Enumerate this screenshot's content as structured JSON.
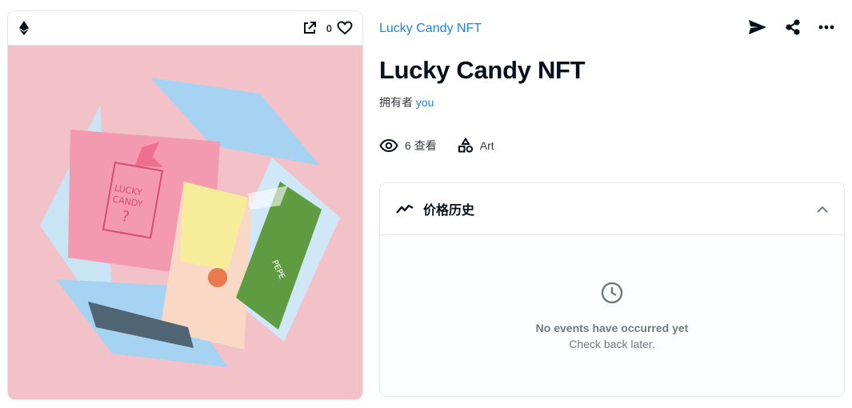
{
  "card": {
    "favorite_count": "0"
  },
  "collection_name": "Lucky Candy NFT",
  "asset_title": "Lucky Candy NFT",
  "owner": {
    "prefix": "拥有者",
    "name": "you"
  },
  "views": {
    "count": "6",
    "label": "查看"
  },
  "category": "Art",
  "price_history": {
    "title": "价格历史",
    "empty_title": "No events have occurred yet",
    "empty_subtitle": "Check back later."
  },
  "artwork": {
    "candy_text_1": "LUCKY",
    "candy_text_2": "CANDY",
    "candy_text_3": "?",
    "wrapper_text": "PEPE"
  },
  "colors": {
    "accent": "#2081e2",
    "text": "#04111d",
    "muted": "#707a83",
    "art_bg": "#f3c2c9"
  }
}
